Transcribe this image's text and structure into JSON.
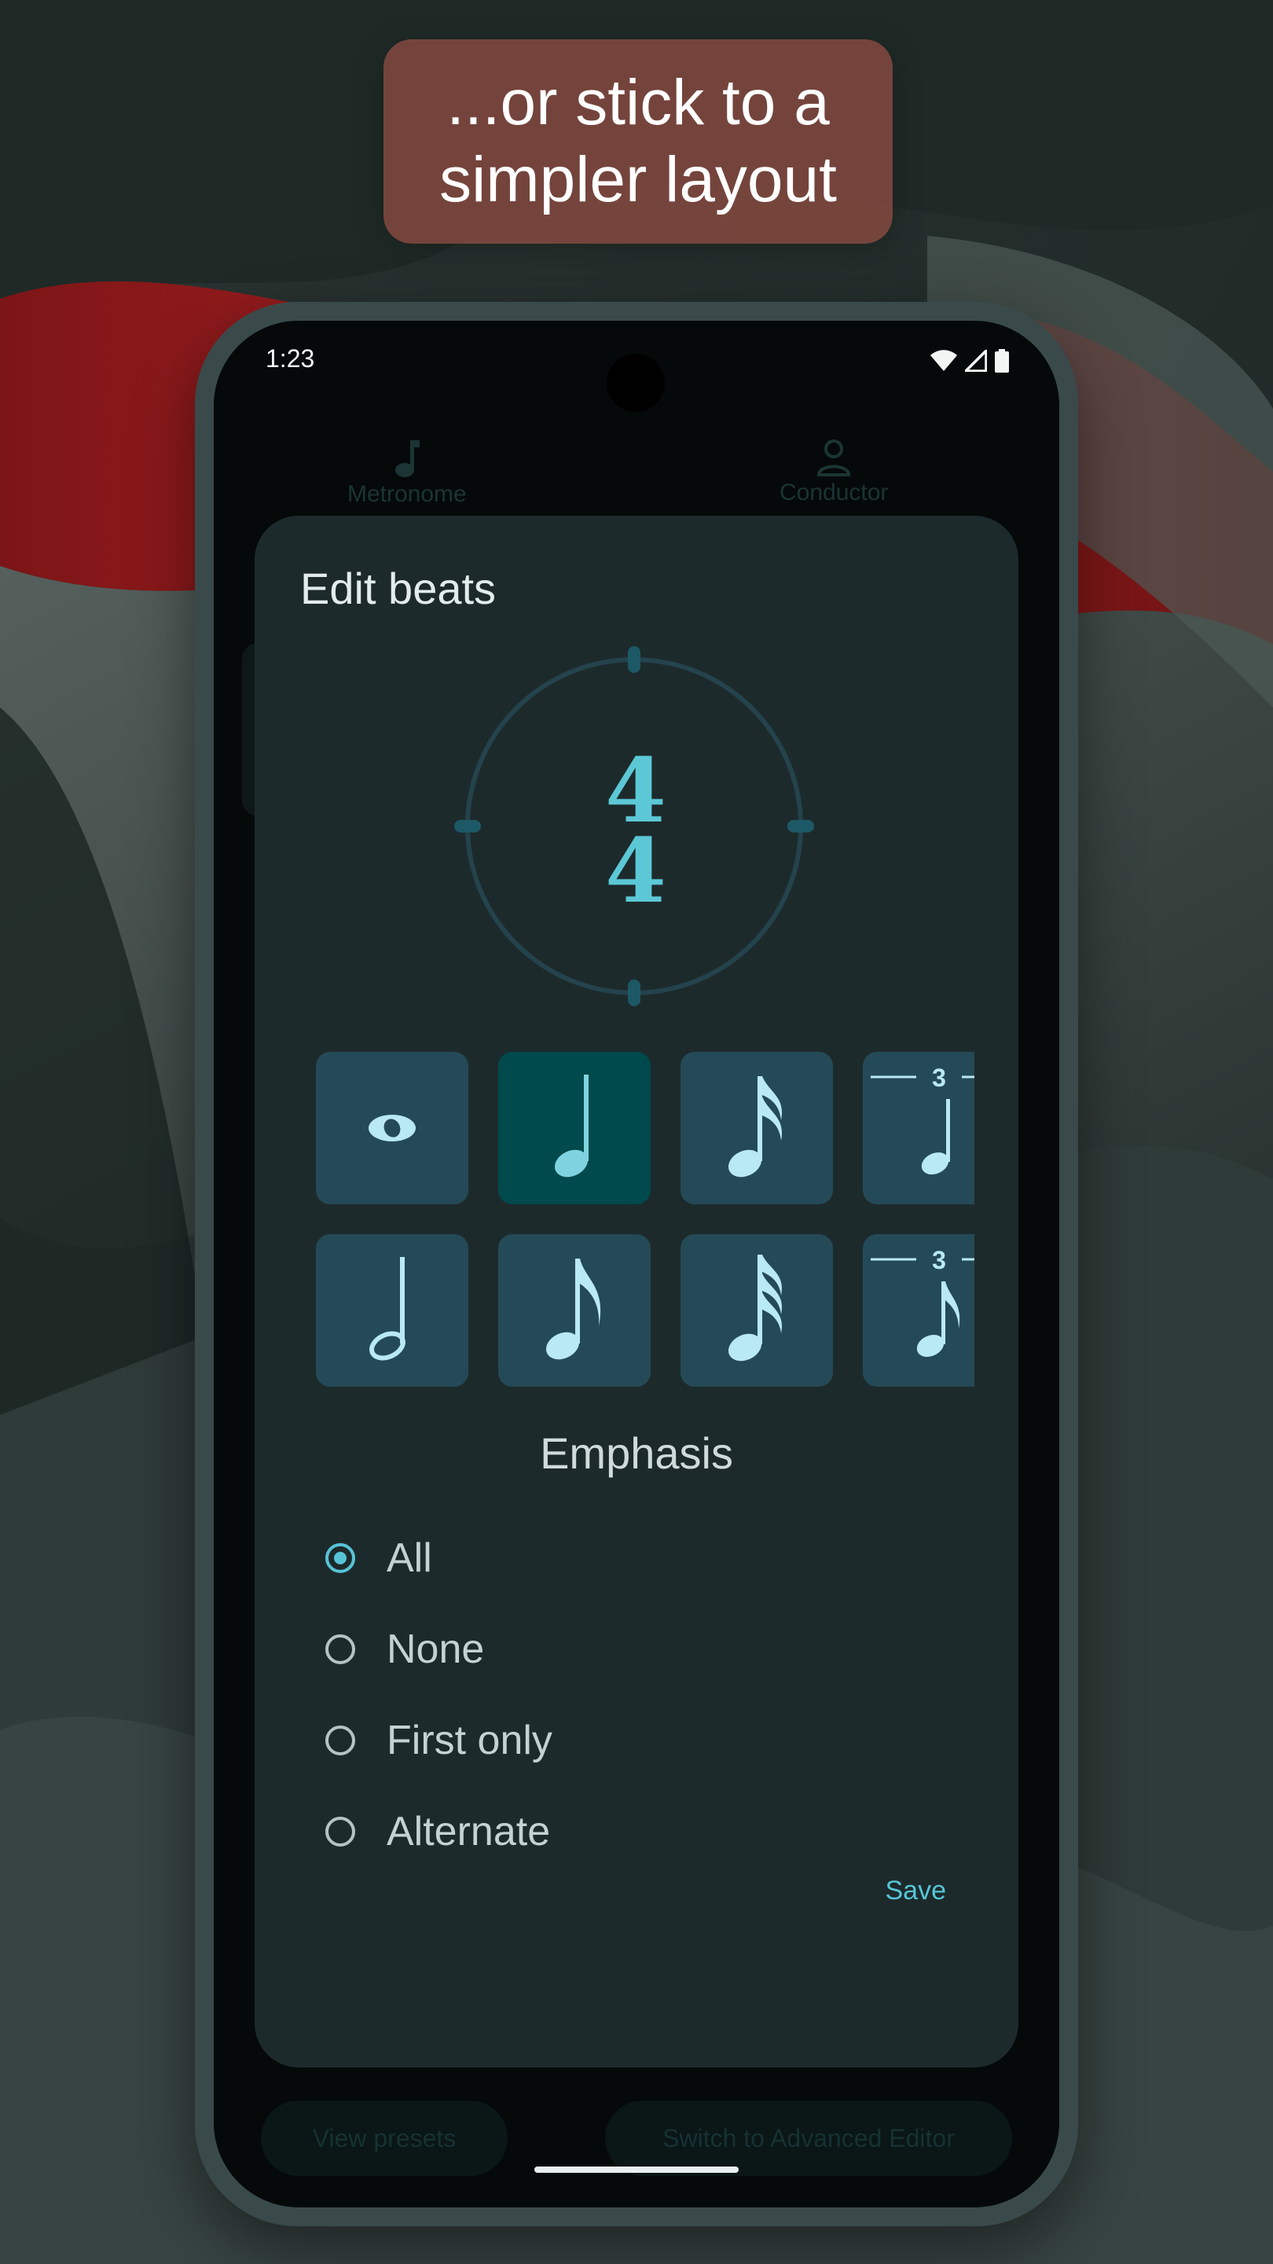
{
  "caption": {
    "text": "...or stick to a simpler layout"
  },
  "status_bar": {
    "time": "1:23",
    "icons": [
      "wifi-icon",
      "signal-icon",
      "battery-icon"
    ]
  },
  "tabs": [
    {
      "label": "Metronome",
      "icon": "music-note-icon"
    },
    {
      "label": "Conductor",
      "icon": "person-icon"
    }
  ],
  "dialog": {
    "title": "Edit beats",
    "time_signature": {
      "numerator": "4",
      "denominator": "4"
    },
    "note_values": [
      {
        "name": "whole-note",
        "selected": false
      },
      {
        "name": "quarter-note",
        "selected": true
      },
      {
        "name": "sixteenth-note",
        "selected": false
      },
      {
        "name": "quarter-note-triplet",
        "triplet_label": "3",
        "selected": false
      },
      {
        "name": "half-note",
        "selected": false
      },
      {
        "name": "eighth-note",
        "selected": false
      },
      {
        "name": "thirty-second-note",
        "selected": false
      },
      {
        "name": "eighth-note-triplet",
        "triplet_label": "3",
        "selected": false
      }
    ],
    "emphasis_heading": "Emphasis",
    "emphasis_options": [
      {
        "label": "All",
        "selected": true
      },
      {
        "label": "None",
        "selected": false
      },
      {
        "label": "First only",
        "selected": false
      },
      {
        "label": "Alternate",
        "selected": false
      }
    ],
    "save_label": "Save"
  },
  "bottom_actions": {
    "presets_label": "View presets",
    "advanced_label": "Switch to Advanced Editor"
  },
  "colors": {
    "accent": "#56c4d6",
    "dialog_bg": "#1d2a2c",
    "tile_bg": "#254a57",
    "tile_selected_bg": "#00494d",
    "caption_bg": "#874b41"
  }
}
